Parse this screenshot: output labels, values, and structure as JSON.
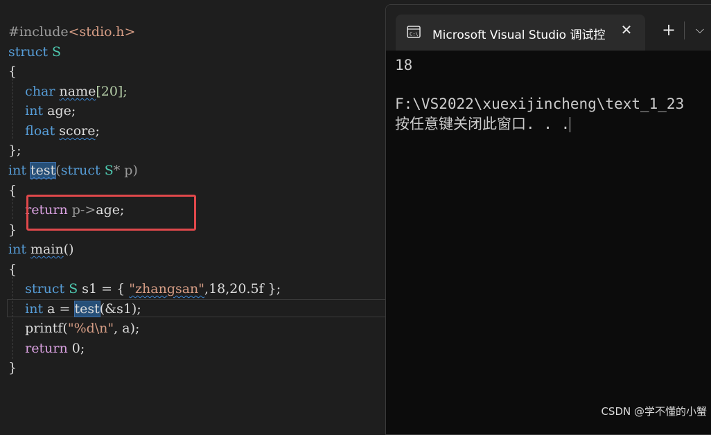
{
  "editor": {
    "lines": {
      "l1": {
        "directive": "#include",
        "header": "<stdio.h>"
      },
      "l2": {
        "kw": "struct",
        "name": "S"
      },
      "l3": {
        "brace": "{"
      },
      "l4": {
        "type": "char",
        "field": "name",
        "rest": "[20];"
      },
      "l5": {
        "type": "int",
        "field": "age",
        "rest": ";"
      },
      "l6": {
        "type": "float",
        "field": "score",
        "rest": ";"
      },
      "l7": {
        "brace": "};"
      },
      "l8": {
        "ret": "int",
        "fn": "test",
        "open": "(",
        "kw": "struct",
        "type": "S",
        "ptr": "* p",
        "close": ")"
      },
      "l9": {
        "brace": "{"
      },
      "l10": {
        "kw": "return",
        "expr": " p->",
        "field": "age",
        "end": ";"
      },
      "l11": {
        "brace": "}"
      },
      "l12": {
        "ret": "int",
        "fn": "main",
        "parens": "()"
      },
      "l13": {
        "brace": "{"
      },
      "l14": {
        "kw": "struct",
        "type": "S",
        "var": "s1",
        "eq": " = { ",
        "str": "\"zhangsan\"",
        "nums": ",18,20.5f",
        "end": " };"
      },
      "l15": {
        "type": "int",
        "var": "a",
        "eq": " = ",
        "fn": "test",
        "args": "(&s1);"
      },
      "l16": {
        "fn": "printf",
        "open": "(",
        "fmt": "\"%d\\n\"",
        "rest": ", a);"
      },
      "l17": {
        "kw": "return",
        "num": " 0",
        "end": ";"
      },
      "l18": {
        "brace": "}"
      }
    }
  },
  "console": {
    "tab_title": "Microsoft Visual Studio 调试控",
    "close_glyph": "✕",
    "new_tab_glyph": "+",
    "dropdown_glyph": "⌵",
    "icon": "terminal-icon",
    "output": [
      "18",
      "",
      "F:\\VS2022\\xuexijincheng\\text_1_23",
      "按任意键关闭此窗口. . ."
    ]
  },
  "watermark": "CSDN @学不懂的小蟹",
  "colors": {
    "editor_bg": "#1e1e1e",
    "keyword": "#569cd6",
    "type": "#4ec9b0",
    "control": "#d8a0df",
    "string": "#d69d85",
    "highlight_box": "#e0484b",
    "console_bg": "#0c0c0c"
  }
}
